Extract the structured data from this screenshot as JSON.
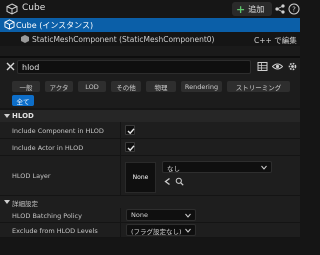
{
  "titlebar": {
    "title": "Cube",
    "add_label": "追加"
  },
  "tree": {
    "root_label": "Cube (インスタンス)",
    "child_label": "StaticMeshComponent (StaticMeshComponent0)",
    "cpp_link": "C++ で編集"
  },
  "search": {
    "value": "hlod",
    "placeholder": ""
  },
  "categories": [
    "一般",
    "アクタ",
    "LOD",
    "その他",
    "物理",
    "Rendering",
    "ストリーミング",
    "全て"
  ],
  "hlod_section": {
    "title": "HLOD",
    "include_component_label": "Include Component in HLOD",
    "include_actor_label": "Include Actor in HLOD",
    "hlod_layer_label": "HLOD Layer",
    "hlod_layer_thumb": "None",
    "hlod_layer_value": "なし",
    "include_component_checked": true,
    "include_actor_checked": true
  },
  "advanced_section": {
    "title": "詳細設定",
    "batching_label": "HLOD Batching Policy",
    "batching_value": "None",
    "exclude_label": "Exclude from HLOD Levels",
    "exclude_value": "(フラグ設定なし)"
  },
  "colors": {
    "selected_row": "#0b5fa8",
    "active_category": "#0d6ec9",
    "add_plus": "#5fc46c"
  }
}
